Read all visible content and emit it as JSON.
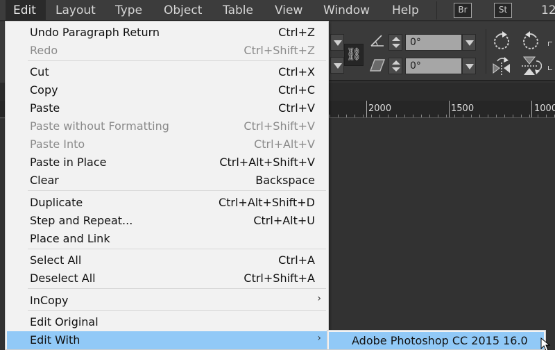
{
  "menubar": {
    "items": [
      {
        "label": "Edit",
        "active": true
      },
      {
        "label": "Layout"
      },
      {
        "label": "Type"
      },
      {
        "label": "Object"
      },
      {
        "label": "Table"
      },
      {
        "label": "View"
      },
      {
        "label": "Window"
      },
      {
        "label": "Help"
      }
    ],
    "app_badges": [
      "Br",
      "St"
    ],
    "zoom_readout": "12"
  },
  "control_panel": {
    "rotation_angle": "0°",
    "shear_angle": "0°",
    "icons": [
      "constrain-link-icon",
      "rotation-angle-icon",
      "shear-angle-icon",
      "rotate-cw-icon",
      "rotate-ccw-icon",
      "flip-horizontal-icon",
      "flip-vertical-icon"
    ]
  },
  "ruler": {
    "labels": [
      "2000",
      "1500",
      "1000"
    ]
  },
  "edit_menu": {
    "items": [
      {
        "label": "Undo Paragraph Return",
        "shortcut": "Ctrl+Z",
        "enabled": true
      },
      {
        "label": "Redo",
        "shortcut": "Ctrl+Shift+Z",
        "enabled": false
      },
      {
        "label": "Cut",
        "shortcut": "Ctrl+X",
        "enabled": true
      },
      {
        "label": "Copy",
        "shortcut": "Ctrl+C",
        "enabled": true
      },
      {
        "label": "Paste",
        "shortcut": "Ctrl+V",
        "enabled": true
      },
      {
        "label": "Paste without Formatting",
        "shortcut": "Ctrl+Shift+V",
        "enabled": false
      },
      {
        "label": "Paste Into",
        "shortcut": "Ctrl+Alt+V",
        "enabled": false
      },
      {
        "label": "Paste in Place",
        "shortcut": "Ctrl+Alt+Shift+V",
        "enabled": true
      },
      {
        "label": "Clear",
        "shortcut": "Backspace",
        "enabled": true
      },
      {
        "label": "Duplicate",
        "shortcut": "Ctrl+Alt+Shift+D",
        "enabled": true
      },
      {
        "label": "Step and Repeat...",
        "shortcut": "Ctrl+Alt+U",
        "enabled": true
      },
      {
        "label": "Place and Link",
        "shortcut": "",
        "enabled": true
      },
      {
        "label": "Select All",
        "shortcut": "Ctrl+A",
        "enabled": true
      },
      {
        "label": "Deselect All",
        "shortcut": "Ctrl+Shift+A",
        "enabled": true
      },
      {
        "label": "InCopy",
        "shortcut": "",
        "submenu": true,
        "enabled": true
      },
      {
        "label": "Edit Original",
        "shortcut": "",
        "enabled": true
      },
      {
        "label": "Edit With",
        "shortcut": "",
        "submenu": true,
        "enabled": true,
        "highlighted": true
      }
    ],
    "submenu_arrow": "›"
  },
  "edit_with_submenu": {
    "items": [
      {
        "label": "Adobe Photoshop CC 2015 16.0",
        "highlighted": true
      }
    ]
  },
  "colors": {
    "menu_bg": "#f2f2f2",
    "highlight": "#91c9f7",
    "disabled_text": "#8a8a8a",
    "app_chrome": "#3c3c3c"
  }
}
